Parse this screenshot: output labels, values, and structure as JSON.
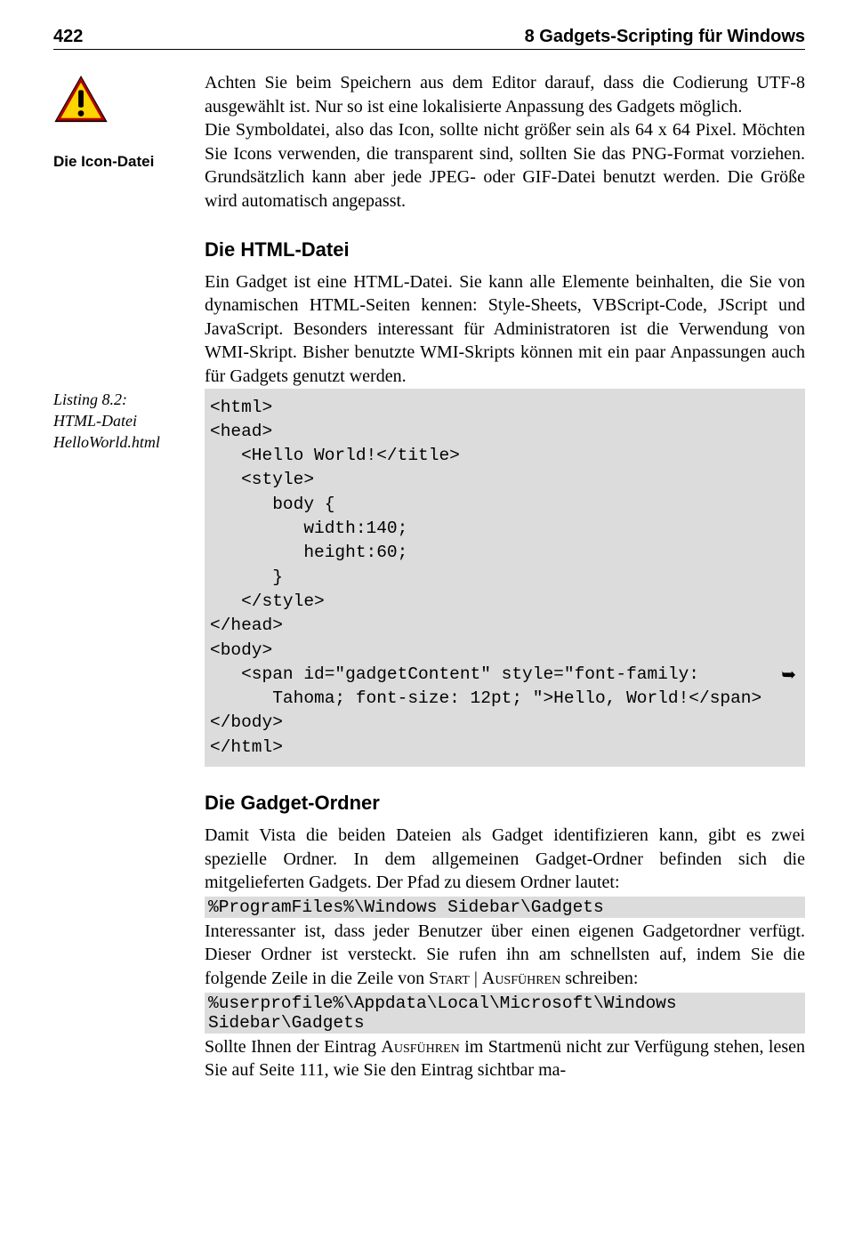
{
  "header": {
    "page_number": "422",
    "chapter_title": "8 Gadgets-Scripting für Windows"
  },
  "margin": {
    "icon_label": "Die Icon-Datei",
    "listing_caption_line1": "Listing 8.2:",
    "listing_caption_line2": "HTML-Datei",
    "listing_caption_line3": "HelloWorld.html"
  },
  "para1": "Achten Sie beim Speichern aus dem Editor darauf, dass die Codierung UTF-8 ausgewählt ist. Nur so ist eine lokalisierte Anpassung des Gad­gets möglich.",
  "para2": "Die Symboldatei, also das Icon, sollte nicht größer sein als 64 x 64 Pi­xel. Möchten Sie Icons verwenden, die transparent sind, sollten Sie das PNG-Format vorziehen. Grundsätzlich kann aber jede JPEG- oder GIF-Datei benutzt werden. Die Größe wird automatisch angepasst.",
  "section2_heading": "Die HTML-Datei",
  "para3": "Ein Gadget ist eine HTML-Datei. Sie kann alle Elemente beinhalten, die Sie von dynamischen HTML-Seiten kennen: Style-Sheets, VBScript-Code, JScript und JavaScript. Besonders interessant für Ad­ministratoren ist die Verwendung von WMI-Skript. Bisher benutzte WMI-Skripts können mit ein paar Anpassungen auch für Gadgets genutzt werden.",
  "code1": "<html>\n<head>\n   <Hello World!</title>\n   <style>\n      body {\n         width:140;\n         height:60;\n      }\n   </style>\n</head>\n<body>\n   <span id=\"gadgetContent\" style=\"font-family:",
  "code1_cont_symbol": "➥",
  "code1b": "      Tahoma; font-size: 12pt; \">Hello, World!</span>\n</body>\n</html>",
  "section3_heading": "Die Gadget-Ordner",
  "para4": "Damit Vista die beiden Dateien als Gadget identifizieren kann, gibt es zwei spezielle Ordner. In dem allgemeinen Gadget-Ordner befinden sich die mitgelieferten Gadgets. Der Pfad zu diesem Ordner lautet:",
  "code2": "%ProgramFiles%\\Windows Sidebar\\Gadgets",
  "para5_a": "Interessanter ist, dass jeder Benutzer über einen eigenen Gadgetordner verfügt. Dieser Ordner ist versteckt. Sie rufen ihn am schnellsten auf, indem Sie die folgende Zeile in die Zeile von ",
  "para5_start": "Start",
  "para5_sep": " | ",
  "para5_ausf": "Ausführen",
  "para5_b": " schreiben:",
  "code3": "%userprofile%\\Appdata\\Local\\Microsoft\\Windows Sidebar\\Gadgets",
  "para6_a": "Sollte Ihnen der Eintrag ",
  "para6_ausf": "Ausführen",
  "para6_b": " im Startmenü nicht zur Verfü­gung stehen, lesen Sie auf Seite 111, wie Sie den Eintrag sichtbar ma-"
}
